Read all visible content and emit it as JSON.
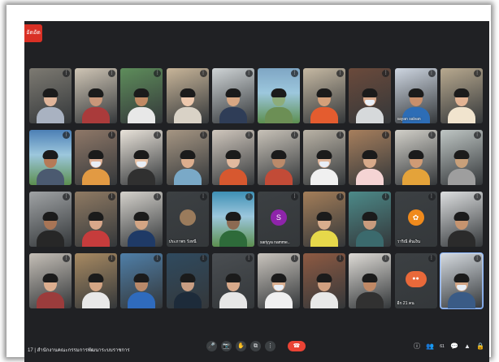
{
  "recording_badge": "อัดอัด",
  "meeting": {
    "time": "17",
    "title": "สำนักงานคณะกรรมการพัฒนาระบบราชการ"
  },
  "tiles": [
    {
      "id": "t1",
      "name": "",
      "bg": "#7d7a72",
      "skin": "#e0b59a",
      "shirt": "#a9b2c1"
    },
    {
      "id": "t2",
      "name": "",
      "bg": "#cfc5b5",
      "skin": "#c99779",
      "shirt": "#aa3b3b"
    },
    {
      "id": "t3",
      "name": "",
      "bg": "#5e8d5b",
      "skin": "#c08a64",
      "shirt": "#e8e8e8"
    },
    {
      "id": "t4",
      "name": "",
      "bg": "#c8b599",
      "skin": "#edc8ad",
      "shirt": "#d9d2c6"
    },
    {
      "id": "t5",
      "name": "",
      "bg": "#cfd4d6",
      "skin": "#d8a783",
      "shirt": "#2f3d57"
    },
    {
      "id": "t6",
      "name": "",
      "bg": "#7fa6c4",
      "skin": "#8dac7a",
      "shirt": "#6c8f55",
      "scene": true
    },
    {
      "id": "t7",
      "name": "",
      "bg": "#c6b9a3",
      "skin": "#d4a07a",
      "shirt": "#e45c2f"
    },
    {
      "id": "t8",
      "name": "",
      "bg": "#6b4a3b",
      "skin": "#d9a98b",
      "shirt": "#d6d9db",
      "mask": true
    },
    {
      "id": "t9",
      "name": "sayan salvan",
      "bg": "#ced6e1",
      "skin": "#c98f6b",
      "shirt": "#2d6db6"
    },
    {
      "id": "t10",
      "name": "",
      "bg": "#b8a98f",
      "skin": "#e2b393",
      "shirt": "#f1e4ce"
    },
    {
      "id": "t11",
      "name": "",
      "bg": "#4c7fb5",
      "skin": "#b57a57",
      "shirt": "#4b5a70",
      "scene": true
    },
    {
      "id": "t12",
      "name": "",
      "bg": "#8f7868",
      "skin": "#e0b196",
      "shirt": "#e29a43",
      "mask": true
    },
    {
      "id": "t13",
      "name": "",
      "bg": "#e9e3da",
      "skin": "#e8c3a7",
      "shirt": "#303030",
      "mask": true
    },
    {
      "id": "t14",
      "name": "",
      "bg": "#a69683",
      "skin": "#dcae8e",
      "shirt": "#7aa9c7"
    },
    {
      "id": "t15",
      "name": "",
      "bg": "#d0c7bd",
      "skin": "#e2b99e",
      "shirt": "#d7582f"
    },
    {
      "id": "t16",
      "name": "",
      "bg": "#c8c2b8",
      "skin": "#ba8a6a",
      "shirt": "#c24b37"
    },
    {
      "id": "t17",
      "name": "",
      "bg": "#bab3a6",
      "skin": "#e0b69a",
      "shirt": "#f0f0f0",
      "mask": true
    },
    {
      "id": "t18",
      "name": "",
      "bg": "#a77f5d",
      "skin": "#d7aa8a",
      "shirt": "#f5d4d4"
    },
    {
      "id": "t19",
      "name": "",
      "bg": "#d2d0c9",
      "skin": "#cf9b75",
      "shirt": "#e4a33a"
    },
    {
      "id": "t20",
      "name": "",
      "bg": "#bfc6c4",
      "skin": "#c8a07a",
      "shirt": "#9e9e9e"
    },
    {
      "id": "t21",
      "name": "",
      "bg": "#a0a3a5",
      "skin": "#a87556",
      "shirt": "#272727"
    },
    {
      "id": "t22",
      "name": "",
      "bg": "#8f7a63",
      "skin": "#d9a88a",
      "shirt": "#c63c3c"
    },
    {
      "id": "t23",
      "name": "",
      "bg": "#d5d2cc",
      "skin": "#d3a584",
      "shirt": "#1f3a66"
    },
    {
      "id": "t24",
      "name": "ประภาพร วังหนี",
      "bg": "#3c4043",
      "avatar": "photo",
      "avatar_color": "#9a7b5c"
    },
    {
      "id": "t25",
      "name": "",
      "bg": "#3d8fb4",
      "skin": "#8c6a52",
      "shirt": "#2e6b3a",
      "scene": true
    },
    {
      "id": "t26",
      "name": "sariyya namme..",
      "bg": "#3c4043",
      "avatar": "S",
      "avatar_color": "#8e24aa"
    },
    {
      "id": "t27",
      "name": "",
      "bg": "#a47e59",
      "skin": "#d9ad8d",
      "shirt": "#e6d84a"
    },
    {
      "id": "t28",
      "name": "",
      "bg": "#4c8a89",
      "skin": "#c79b7d",
      "shirt": "#3b6a6d"
    },
    {
      "id": "t29",
      "name": "วาริณี ต้นเงิน",
      "bg": "#3c4043",
      "avatar": "flower",
      "avatar_color": "#f08a1c"
    },
    {
      "id": "t30",
      "name": "",
      "bg": "#dddfe0",
      "skin": "#c6946f",
      "shirt": "#2b2b2b"
    },
    {
      "id": "t31",
      "name": "",
      "bg": "#c5bfb7",
      "skin": "#dcae8f",
      "shirt": "#9b3c3c"
    },
    {
      "id": "t32",
      "name": "",
      "bg": "#a88a62",
      "skin": "#d4a584",
      "shirt": "#e8e8e8"
    },
    {
      "id": "t33",
      "name": "",
      "bg": "#4f7fa8",
      "skin": "#b9896a",
      "shirt": "#2f6bbd"
    },
    {
      "id": "t34",
      "name": "",
      "bg": "#2f4a5f",
      "skin": "#c99e83",
      "shirt": "#1d2b3a"
    },
    {
      "id": "t35",
      "name": "",
      "bg": "#4a4e52",
      "skin": "#d8a98a",
      "shirt": "#e6e6e6"
    },
    {
      "id": "t36",
      "name": "",
      "bg": "#c9c4bd",
      "skin": "#d9ae8f",
      "shirt": "#f0f0f0",
      "mask": true
    },
    {
      "id": "t37",
      "name": "",
      "bg": "#8e5a42",
      "skin": "#d0a080",
      "shirt": "#e8e8e8"
    },
    {
      "id": "t38",
      "name": "",
      "bg": "#dedbd6",
      "skin": "#c08966",
      "shirt": "#313131"
    },
    {
      "id": "t39",
      "name": "อีก 21 คน",
      "bg": "#3c4043",
      "avatar": "group",
      "avatar_color": "#e9693a"
    },
    {
      "id": "t40",
      "name": "",
      "bg": "#d6dbe0",
      "skin": "#d3a585",
      "shirt": "#3a5b86",
      "mask": true,
      "active": true
    }
  ],
  "controls": {
    "mic_icon": "🎤",
    "camera_icon": "📷",
    "hand_icon": "✋",
    "present_icon": "⧉",
    "more_icon": "⋮",
    "hangup_icon": "☎"
  },
  "right_controls": {
    "info_icon": "ⓘ",
    "people_icon": "👥",
    "people_count": "61",
    "chat_icon": "💬",
    "activities_icon": "▲",
    "lock_icon": "🔒"
  }
}
